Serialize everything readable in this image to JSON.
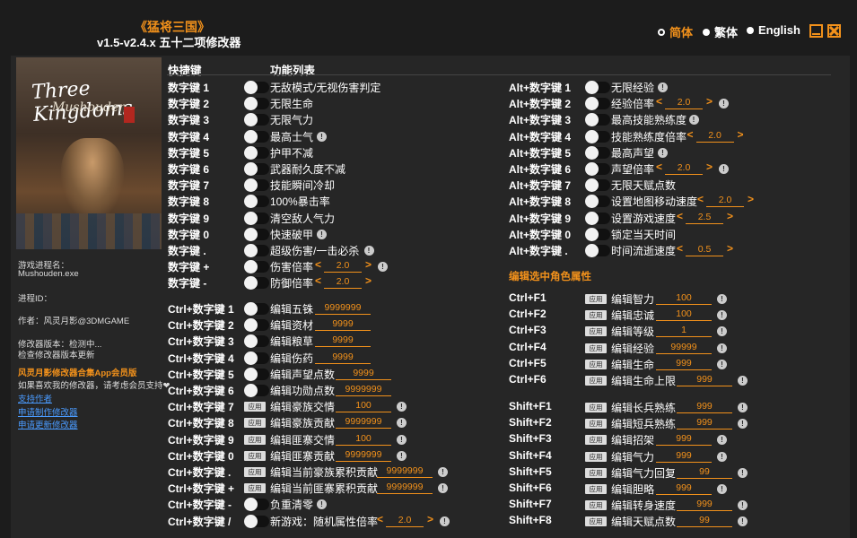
{
  "header": {
    "game_title": "《猛将三国》",
    "version": "v1.5-v2.4.x 五十二项修改器",
    "langs": [
      {
        "label": "简体",
        "selected": true
      },
      {
        "label": "繁体",
        "selected": false
      },
      {
        "label": "English",
        "selected": false
      }
    ]
  },
  "cover": {
    "line1": "Three Kingdoms",
    "line2": "Mushouden"
  },
  "sidebar": {
    "process_label": "游戏进程名：",
    "process_name": "Mushouden.exe",
    "pid_label": "进程ID：",
    "author": "作者：风灵月影@3DMGAME",
    "version_label": "修改器版本：检测中...",
    "check_version": "检查修改器版本更新",
    "promo": "风灵月影修改器合集App会员版",
    "donate_text": "如果喜欢我的修改器，请考虑会员支持❤",
    "support": "支持作者",
    "request_new": "申请制作修改器",
    "request_update": "申请更新修改器"
  },
  "columns": {
    "hotkey": "快捷键",
    "function": "功能列表"
  },
  "left_list": [
    {
      "key": "数字键 1",
      "type": "toggle",
      "label": "无敌模式/无视伤害判定"
    },
    {
      "key": "数字键 2",
      "type": "toggle",
      "label": "无限生命"
    },
    {
      "key": "数字键 3",
      "type": "toggle",
      "label": "无限气力"
    },
    {
      "key": "数字键 4",
      "type": "toggle",
      "label": "最高士气",
      "info": "!"
    },
    {
      "key": "数字键 5",
      "type": "toggle",
      "label": "护甲不减"
    },
    {
      "key": "数字键 6",
      "type": "toggle",
      "label": "武器耐久度不减"
    },
    {
      "key": "数字键 7",
      "type": "toggle",
      "label": "技能瞬间冷却"
    },
    {
      "key": "数字键 8",
      "type": "toggle",
      "label": "100%暴击率"
    },
    {
      "key": "数字键 9",
      "type": "toggle",
      "label": "清空敌人气力"
    },
    {
      "key": "数字键 0",
      "type": "toggle",
      "label": "快速破甲",
      "info": "!"
    },
    {
      "key": "数字键 .",
      "type": "toggle",
      "label": "超级伤害/一击必杀",
      "info": "!"
    },
    {
      "key": "数字键 +",
      "type": "toggle",
      "label": "伤害倍率",
      "value": "2.0",
      "arrows": true,
      "info": "!"
    },
    {
      "key": "数字键 -",
      "type": "toggle",
      "label": "防御倍率",
      "value": "2.0",
      "arrows": true
    },
    {
      "key": "Ctrl+数字键 1",
      "type": "toggle",
      "label": "编辑五铢",
      "value": "9999999"
    },
    {
      "key": "Ctrl+数字键 2",
      "type": "toggle",
      "label": "编辑资材",
      "value": "9999"
    },
    {
      "key": "Ctrl+数字键 3",
      "type": "toggle",
      "label": "编辑粮草",
      "value": "9999"
    },
    {
      "key": "Ctrl+数字键 4",
      "type": "toggle",
      "label": "编辑伤药",
      "value": "9999"
    },
    {
      "key": "Ctrl+数字键 5",
      "type": "toggle",
      "label": "编辑声望点数",
      "value": "9999"
    },
    {
      "key": "Ctrl+数字键 6",
      "type": "toggle",
      "label": "编辑功勋点数",
      "value": "9999999"
    },
    {
      "key": "Ctrl+数字键 7",
      "type": "apply",
      "label": "编辑豪族交情",
      "value": "100",
      "info": "!"
    },
    {
      "key": "Ctrl+数字键 8",
      "type": "apply",
      "label": "编辑豪族贡献",
      "value": "9999999",
      "info": "!"
    },
    {
      "key": "Ctrl+数字键 9",
      "type": "apply",
      "label": "编辑匪寨交情",
      "value": "100",
      "info": "!"
    },
    {
      "key": "Ctrl+数字键 0",
      "type": "apply",
      "label": "编辑匪寨贡献",
      "value": "9999999",
      "info": "!"
    },
    {
      "key": "Ctrl+数字键 .",
      "type": "apply",
      "label": "编辑当前豪族累积贡献",
      "value": "9999999",
      "info": "!"
    },
    {
      "key": "Ctrl+数字键 +",
      "type": "apply",
      "label": "编辑当前匪寨累积贡献",
      "value": "9999999",
      "info": "!"
    },
    {
      "key": "Ctrl+数字键 -",
      "type": "toggle",
      "label": "负重清零",
      "info": "!"
    },
    {
      "key": "Ctrl+数字键 /",
      "type": "toggle",
      "label": "新游戏：随机属性倍率",
      "value": "2.0",
      "arrows": true,
      "info": "!"
    }
  ],
  "right_list": [
    {
      "key": "Alt+数字键 1",
      "type": "toggle",
      "label": "无限经验",
      "info": "!"
    },
    {
      "key": "Alt+数字键 2",
      "type": "toggle",
      "label": "经验倍率",
      "value": "2.0",
      "arrows": true,
      "info": "!"
    },
    {
      "key": "Alt+数字键 3",
      "type": "toggle",
      "label": "最高技能熟练度",
      "info": "!"
    },
    {
      "key": "Alt+数字键 4",
      "type": "toggle",
      "label": "技能熟练度倍率",
      "value": "2.0",
      "arrows": true
    },
    {
      "key": "Alt+数字键 5",
      "type": "toggle",
      "label": "最高声望",
      "info": "!"
    },
    {
      "key": "Alt+数字键 6",
      "type": "toggle",
      "label": "声望倍率",
      "value": "2.0",
      "arrows": true,
      "info": "!"
    },
    {
      "key": "Alt+数字键 7",
      "type": "toggle",
      "label": "无限天赋点数"
    },
    {
      "key": "Alt+数字键 8",
      "type": "toggle",
      "label": "设置地图移动速度",
      "value": "2.0",
      "arrows": true
    },
    {
      "key": "Alt+数字键 9",
      "type": "toggle",
      "label": "设置游戏速度",
      "value": "2.5",
      "arrows": true
    },
    {
      "key": "Alt+数字键 0",
      "type": "toggle",
      "label": "锁定当天时间"
    },
    {
      "key": "Alt+数字键 .",
      "type": "toggle",
      "label": "时间流逝速度",
      "value": "0.5",
      "arrows": true
    }
  ],
  "edit_section_title": "编辑选中角色属性",
  "ctrl_f": [
    {
      "key": "Ctrl+F1",
      "label": "编辑智力",
      "value": "100",
      "info": "!"
    },
    {
      "key": "Ctrl+F2",
      "label": "编辑忠诚",
      "value": "100",
      "info": "!"
    },
    {
      "key": "Ctrl+F3",
      "label": "编辑等级",
      "value": "1",
      "info": "!"
    },
    {
      "key": "Ctrl+F4",
      "label": "编辑经验",
      "value": "99999",
      "info": "!"
    },
    {
      "key": "Ctrl+F5",
      "label": "编辑生命",
      "value": "999",
      "info": "!"
    },
    {
      "key": "Ctrl+F6",
      "label": "编辑生命上限",
      "value": "999",
      "info": "!"
    }
  ],
  "shift_f": [
    {
      "key": "Shift+F1",
      "label": "编辑长兵熟练",
      "value": "999",
      "info": "!"
    },
    {
      "key": "Shift+F2",
      "label": "编辑短兵熟练",
      "value": "999",
      "info": "!"
    },
    {
      "key": "Shift+F3",
      "label": "编辑招架",
      "value": "999",
      "info": "!"
    },
    {
      "key": "Shift+F4",
      "label": "编辑气力",
      "value": "999",
      "info": "!"
    },
    {
      "key": "Shift+F5",
      "label": "编辑气力回复",
      "value": "99",
      "info": "!"
    },
    {
      "key": "Shift+F6",
      "label": "编辑胆略",
      "value": "999",
      "info": "!"
    },
    {
      "key": "Shift+F7",
      "label": "编辑转身速度",
      "value": "999",
      "info": "!"
    },
    {
      "key": "Shift+F8",
      "label": "编辑天赋点数",
      "value": "99",
      "info": "!"
    }
  ],
  "apply_label": "应用",
  "arrow_left": "<",
  "arrow_right": ">"
}
